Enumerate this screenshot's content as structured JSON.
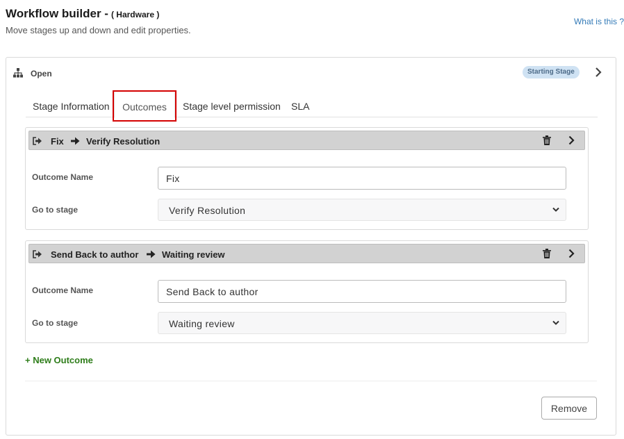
{
  "header": {
    "title": "Workflow builder -",
    "title_sub": "( Hardware )",
    "subtitle": "Move stages up and down and edit properties.",
    "help_link": "What is this ?"
  },
  "stage": {
    "icon": "sitemap-icon",
    "name": "Open",
    "badge": "Starting Stage",
    "tabs": [
      {
        "label": "Stage Information",
        "active": false
      },
      {
        "label": "Outcomes",
        "active": true
      },
      {
        "label": "Stage level permission",
        "active": false
      },
      {
        "label": "SLA",
        "active": false
      }
    ],
    "outcomes": [
      {
        "from": "Fix",
        "to": "Verify Resolution",
        "outcome_name_label": "Outcome Name",
        "outcome_name_value": "Fix",
        "go_to_label": "Go to stage",
        "go_to_value": "Verify Resolution"
      },
      {
        "from": "Send Back to author",
        "to": "Waiting review",
        "outcome_name_label": "Outcome Name",
        "outcome_name_value": "Send Back to author",
        "go_to_label": "Go to stage",
        "go_to_value": "Waiting review"
      }
    ],
    "new_outcome_label": "+ New Outcome",
    "remove_label": "Remove"
  },
  "colors": {
    "link": "#337ab7",
    "badge_bg": "#cfe2f3",
    "outcome_bar_bg": "#d2d2d2",
    "new_outcome": "#2e7d1a",
    "highlight": "#d40000"
  }
}
